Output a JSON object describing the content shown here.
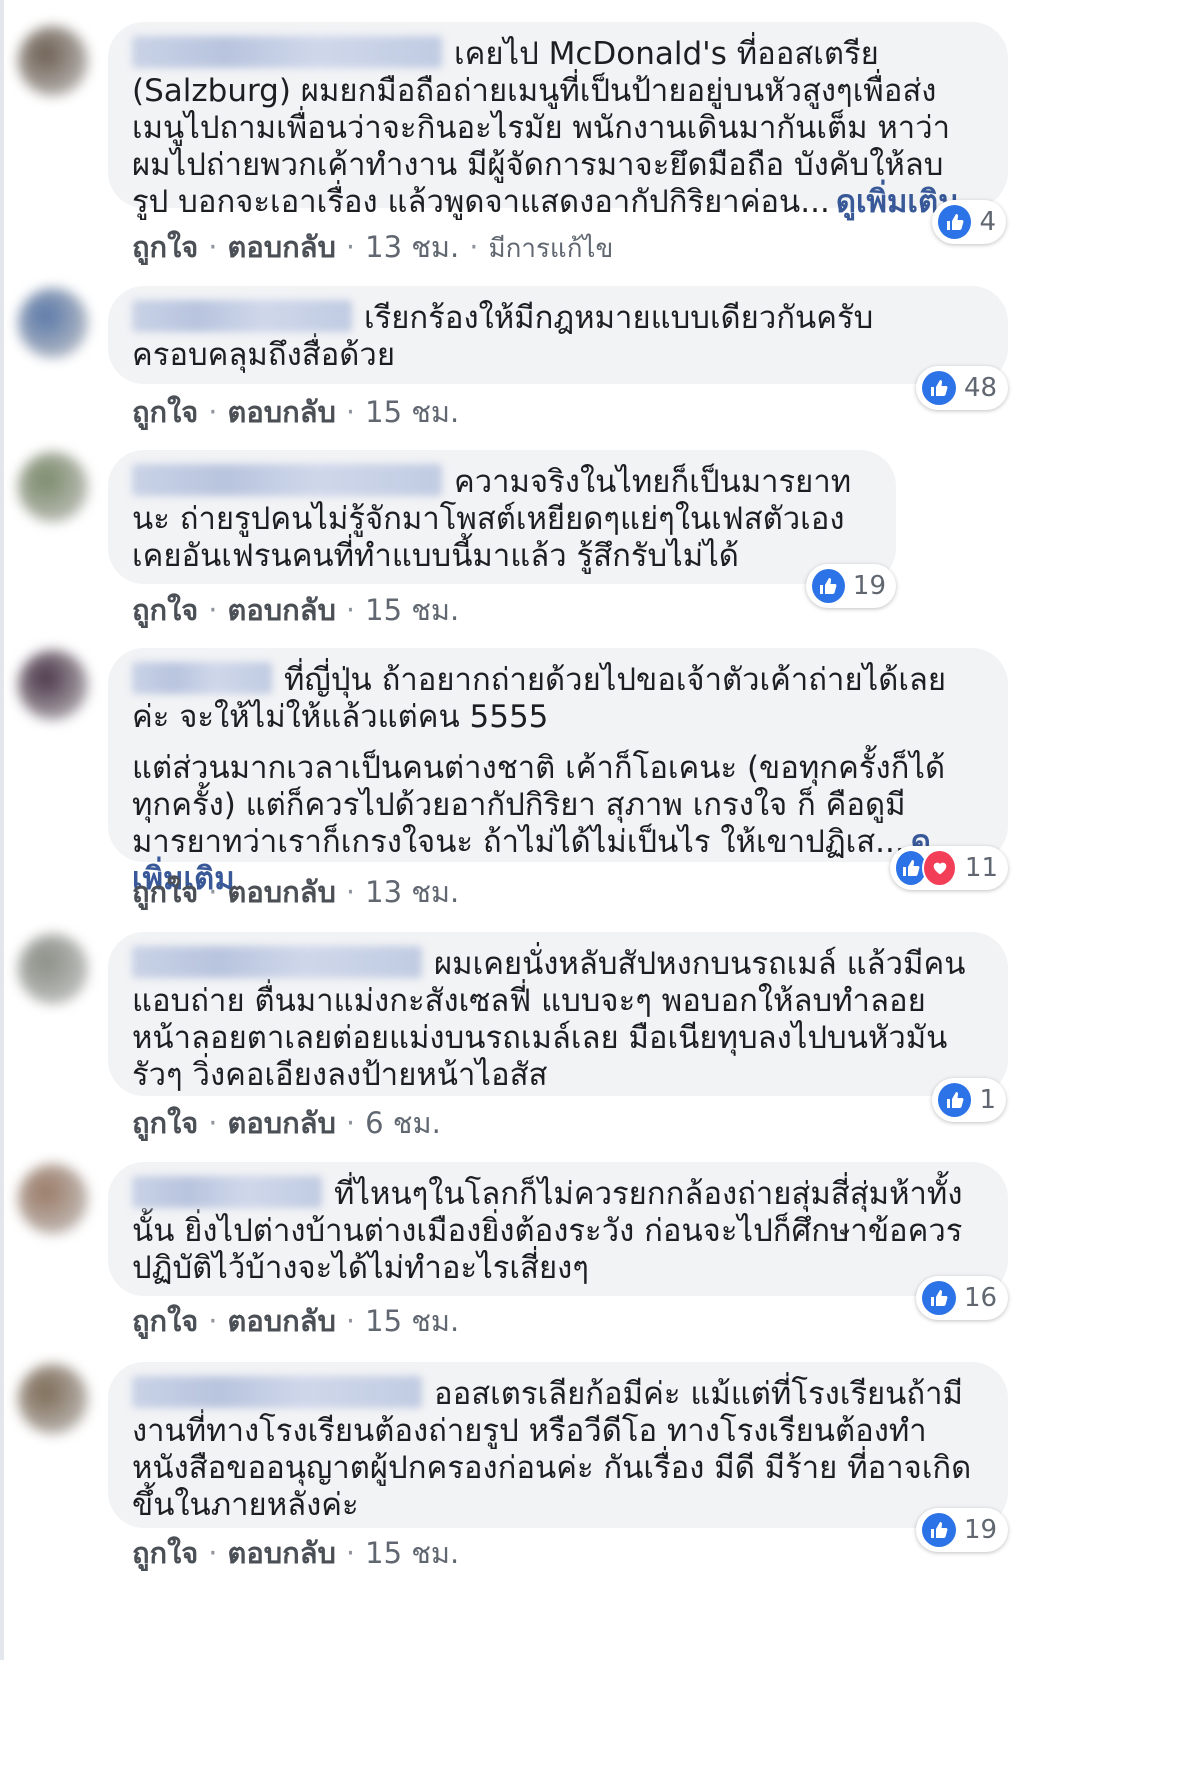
{
  "ui": {
    "like_label": "ถูกใจ",
    "reply_label": "ตอบกลับ",
    "see_more_label": "ดูเพิ่มเติม",
    "separator": "·",
    "edited_label": "มีการแก้ไข",
    "like_color": "#2c73e8",
    "love_color": "#f33e58"
  },
  "comments": [
    {
      "paragraphs": [
        "เคยไป McDonald's ที่ออสเตรีย (Salzburg) ผมยกมือถือถ่ายเมนูที่เป็นป้ายอยู่บนหัวสูงๆเพื่อส่งเมนูไปถามเพื่อนว่าจะกินอะไรมัย พนักงานเดินมากันเต็ม หาว่าผมไปถ่ายพวกเค้าทำงาน มีผู้จัดการมาจะยึดมือถือ บังคับให้ลบรูป บอกจะเอาเรื่อง แล้วพูดจาแสดงอากัปกิริยาค่อน..."
      ],
      "time": "13 ชม.",
      "reaction_count": "4",
      "reactions": [
        "like-icon"
      ],
      "avatar_color": "#6d5f52"
    },
    {
      "paragraphs": [
        "เรียกร้องให้มีกฎหมายแบบเดียวกันครับ ครอบคลุมถึงสื่อด้วย"
      ],
      "time": "15 ชม.",
      "reaction_count": "48",
      "reactions": [
        "like-icon"
      ],
      "avatar_color": "#5a78a8"
    },
    {
      "paragraphs": [
        "ความจริงในไทยก็เป็นมารยาทนะ ถ่ายรูปคนไม่รู้จักมาโพสต์เหยียดๆแย่ๆในเฟสตัวเอง เคยอันเฟรนคนที่ทำแบบนี้มาแล้ว รู้สึกรับไม่ได้"
      ],
      "time": "15 ชม.",
      "reaction_count": "19",
      "reactions": [
        "like-icon"
      ],
      "avatar_color": "#7b8a6a"
    },
    {
      "paragraphs": [
        "ที่ญี่ปุ่น ถ้าอยากถ่ายด้วยไปขอเจ้าตัวเค้าถ่ายได้เลยค่ะ จะให้ไม่ให้แล้วแต่คน 5555",
        "แต่ส่วนมากเวลาเป็นคนต่างชาติ เค้าก็โอเคนะ (ขอทุกครั้งก็ได้ทุกครั้ง) แต่ก็ควรไปด้วยอากัปกิริยา สุภาพ เกรงใจ ก็ คือดูมีมารยาทว่าเราก็เกรงใจนะ ถ้าไม่ได้ไม่เป็นไร ให้เขาปฏิเส..."
      ],
      "time": "13 ชม.",
      "reaction_count": "11",
      "reactions": [
        "like-icon",
        "love-icon"
      ],
      "avatar_color": "#4a3548"
    },
    {
      "paragraphs": [
        "ผมเคยนั่งหลับสัปหงกบนรถเมล์ แล้วมีคนแอบถ่าย ตื่นมาแม่งกะสังเซลฟี่ แบบจะๆ พอบอกให้ลบทำลอยหน้าลอยตาเลยต่อยแม่งบนรถเมล์เลย มือเนียทุบลงไปบนหัวมันรัวๆ วิ่งคอเอียงลงป้ายหน้าไอสัส"
      ],
      "time": "6 ชม.",
      "reaction_count": "1",
      "reactions": [
        "like-icon"
      ],
      "avatar_color": "#8a8f86"
    },
    {
      "paragraphs": [
        "ที่ไหนๆในโลกก็ไม่ควรยกกล้องถ่ายสุ่มสี่สุ่มห้าทั้งนั้น ยิ่งไปต่างบ้านต่างเมืองยิ่งต้องระวัง ก่อนจะไปก็ศึกษาข้อควรปฏิบัติไว้บ้างจะได้ไม่ทำอะไรเสี่ยงๆ"
      ],
      "time": "15 ชม.",
      "reaction_count": "16",
      "reactions": [
        "like-icon"
      ],
      "avatar_color": "#9a7a66"
    },
    {
      "paragraphs": [
        "ออสเตรเลียก้อมีค่ะ แม้แต่ที่โรงเรียนถ้ามีงานที่ทางโรงเรียนต้องถ่ายรูป หรือวีดีโอ ทางโรงเรียนต้องทำหนังสือขออนุญาตผู้ปกครองก่อนค่ะ กันเรื่อง มีดี มีร้าย ที่อาจเกิดขึ้นในภายหลังค่ะ"
      ],
      "time": "15 ชม.",
      "reaction_count": "19",
      "reactions": [
        "like-icon"
      ],
      "avatar_color": "#7d6a55"
    }
  ]
}
